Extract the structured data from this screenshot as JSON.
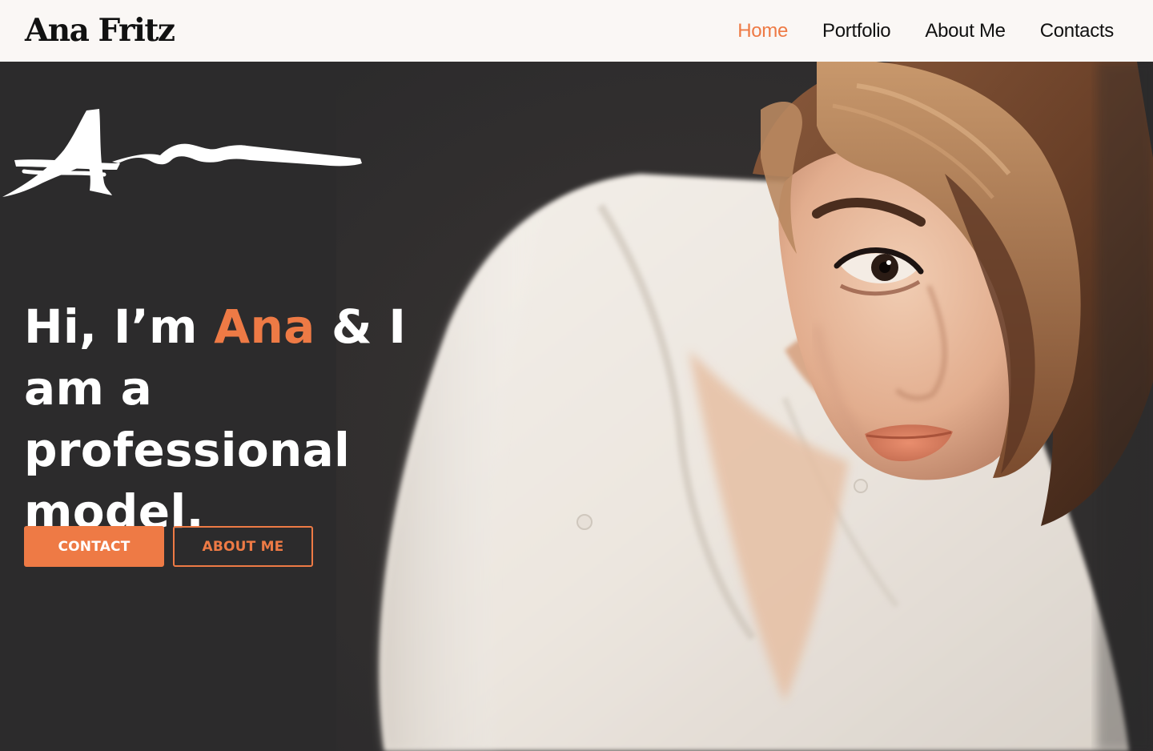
{
  "brand": {
    "name": "Ana Fritz"
  },
  "nav": {
    "items": [
      {
        "label": "Home",
        "active": true
      },
      {
        "label": "Portfolio",
        "active": false
      },
      {
        "label": "About Me",
        "active": false
      },
      {
        "label": "Contacts",
        "active": false
      }
    ]
  },
  "hero": {
    "headline_prefix": "Hi, I’m ",
    "headline_name": "Ana",
    "headline_suffix": " & I am a professional model.",
    "buttons": {
      "contact": "CONTACT",
      "about": "ABOUT ME"
    },
    "signature_icon": "signature-graphic",
    "photo": "portrait-photo"
  },
  "colors": {
    "accent": "#ee7a45",
    "nav_background": "#faf7f5",
    "hero_background": "#2c2b2c",
    "text_light": "#ffffff",
    "text_dark": "#111111"
  }
}
